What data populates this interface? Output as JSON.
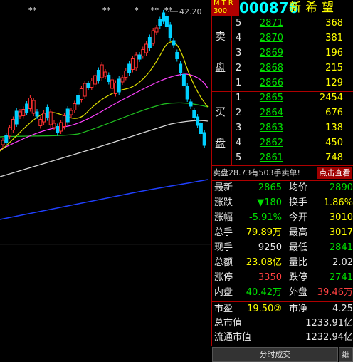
{
  "chart": {
    "peak_label": "42.20",
    "markers": [
      "**",
      "**",
      "*",
      "**",
      "**"
    ]
  },
  "header": {
    "mtr": "MTR",
    "index": "300",
    "code": "000876",
    "name": "新希望"
  },
  "sell": {
    "label": "卖盘",
    "rows": [
      {
        "level": "5",
        "price": "2871",
        "vol": "368"
      },
      {
        "level": "4",
        "price": "2870",
        "vol": "381"
      },
      {
        "level": "3",
        "price": "2869",
        "vol": "196"
      },
      {
        "level": "2",
        "price": "2868",
        "vol": "215"
      },
      {
        "level": "1",
        "price": "2866",
        "vol": "129"
      }
    ]
  },
  "buy": {
    "label": "买盘",
    "rows": [
      {
        "level": "1",
        "price": "2865",
        "vol": "2454"
      },
      {
        "level": "2",
        "price": "2864",
        "vol": "676"
      },
      {
        "level": "3",
        "price": "2863",
        "vol": "138"
      },
      {
        "level": "4",
        "price": "2862",
        "vol": "450"
      },
      {
        "level": "5",
        "price": "2861",
        "vol": "748"
      }
    ]
  },
  "message": {
    "text": "卖盘28.73有503手卖单!",
    "button": "点击查看"
  },
  "stats": [
    {
      "l1": "最新",
      "v1": "2865",
      "c1": "green",
      "l2": "均价",
      "v2": "2890",
      "c2": "green"
    },
    {
      "l1": "涨跌",
      "v1": "▼180",
      "c1": "green",
      "l2": "换手",
      "v2": "1.86%",
      "c2": "yellow"
    },
    {
      "l1": "涨幅",
      "v1": "-5.91%",
      "c1": "green",
      "l2": "今开",
      "v2": "3010",
      "c2": "yellow"
    },
    {
      "l1": "总手",
      "v1": "79.89万",
      "c1": "yellow",
      "l2": "最高",
      "v2": "3017",
      "c2": "yellow"
    },
    {
      "l1": "现手",
      "v1": "9250",
      "c1": "white",
      "l2": "最低",
      "v2": "2841",
      "c2": "green"
    },
    {
      "l1": "总额",
      "v1": "23.08亿",
      "c1": "yellow",
      "l2": "量比",
      "v2": "2.02",
      "c2": "white"
    },
    {
      "l1": "涨停",
      "v1": "3350",
      "c1": "red",
      "l2": "跌停",
      "v2": "2741",
      "c2": "green"
    },
    {
      "l1": "内盘",
      "v1": "40.42万",
      "c1": "green",
      "l2": "外盘",
      "v2": "39.46万",
      "c2": "red"
    }
  ],
  "valuation": {
    "pe_label": "市盈",
    "pe_value": "19.50②",
    "pb_label": "市净",
    "pb_value": "4.25",
    "mcap_label": "总市值",
    "mcap_value": "1233.91亿",
    "float_label": "流通市值",
    "float_value": "1232.94亿"
  },
  "tabs": {
    "main": "分时成交",
    "side": "细"
  }
}
